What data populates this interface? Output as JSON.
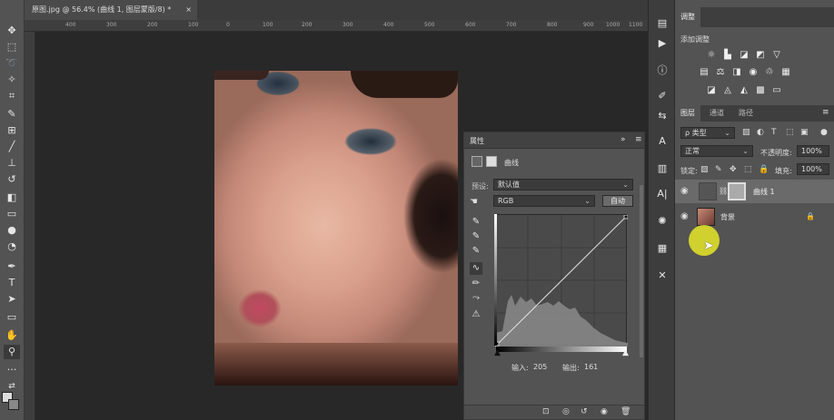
{
  "document_tab": {
    "title": "原图.jpg @ 56.4% (曲线 1, 图层蒙版/8) *",
    "close": "×"
  },
  "ruler_marks": [
    "400",
    "300",
    "200",
    "100",
    "0",
    "100",
    "200",
    "300",
    "400",
    "500",
    "600",
    "700",
    "800",
    "900",
    "1000",
    "1100"
  ],
  "tools": [
    "move-tool",
    "marquee-tool",
    "lasso-tool",
    "magic-wand-tool",
    "crop-tool",
    "eyedropper-tool",
    "healing-tool",
    "brush-tool",
    "stamp-tool",
    "history-brush-tool",
    "eraser-tool",
    "gradient-tool",
    "blur-tool",
    "dodge-tool",
    "pen-tool",
    "type-tool",
    "path-select-tool",
    "shape-tool",
    "hand-tool",
    "zoom-tool",
    "more-tools",
    "swap-colors",
    "color-swatches"
  ],
  "properties": {
    "title": "属性",
    "mode_label": "曲线",
    "preset_label": "预设:",
    "preset_value": "默认值",
    "channel_value": "RGB",
    "auto_button": "自动",
    "input_label": "输入:",
    "input_value": "205",
    "output_label": "输出:",
    "output_value": "161"
  },
  "curve": {
    "input": 205,
    "output": 161,
    "range": [
      0,
      255
    ],
    "points": [
      [
        0,
        0
      ],
      [
        255,
        255
      ]
    ]
  },
  "right_panel": {
    "adjust_tab": "调整",
    "add_adjustment": "添加调整",
    "layer_tabs": [
      "图层",
      "通道",
      "路径"
    ],
    "kind_filter": "ρ 类型",
    "blend_mode": "正常",
    "opacity_label": "不透明度:",
    "opacity_value": "100%",
    "lock_label": "锁定:",
    "fill_label": "填充:",
    "fill_value": "100%",
    "layers": [
      {
        "name": "曲线 1"
      },
      {
        "name": "背景"
      }
    ]
  },
  "colors": {
    "accent": "#e6e628",
    "panel": "#535353",
    "canvas": "#282828"
  }
}
